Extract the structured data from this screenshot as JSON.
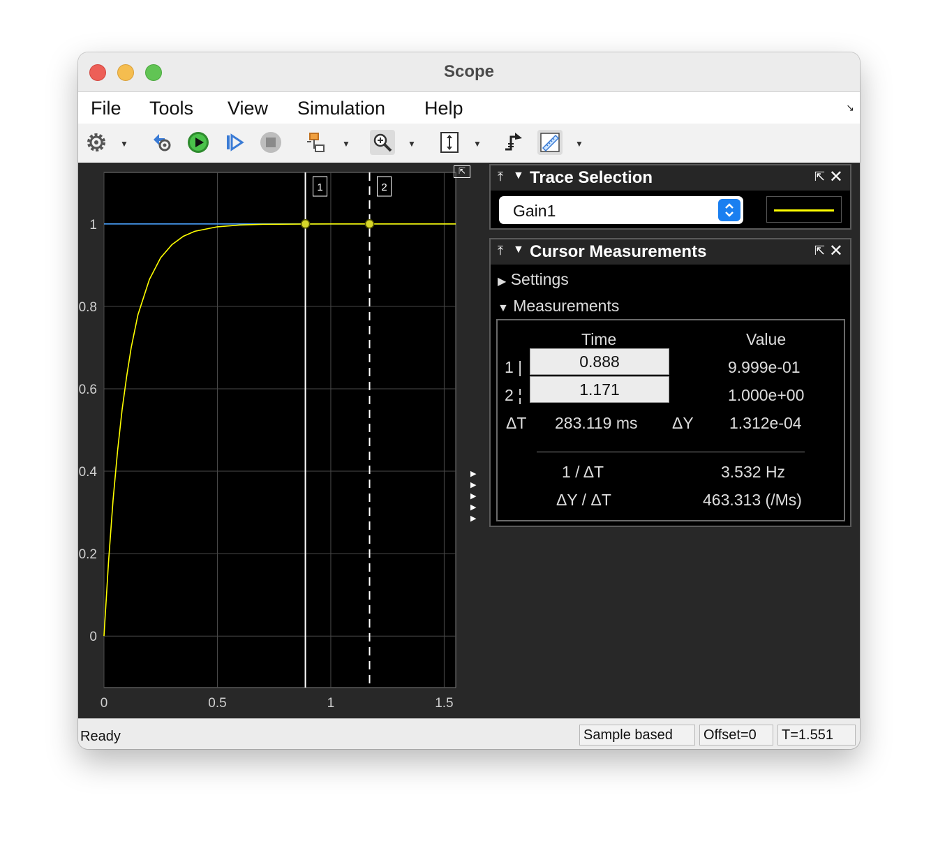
{
  "window": {
    "title": "Scope"
  },
  "menu": [
    "File",
    "Tools",
    "View",
    "Simulation",
    "Help"
  ],
  "toolbar": {
    "icons": [
      "gear-icon",
      "step-back-icon",
      "run-icon",
      "step-forward-icon",
      "stop-icon",
      "highlight-block-icon",
      "zoom-in-icon",
      "scale-axes-icon",
      "triggers-icon",
      "cursor-measurements-icon"
    ]
  },
  "chart_data": {
    "type": "line",
    "title": "",
    "xlabel": "",
    "ylabel": "",
    "xlim": [
      0,
      1.551
    ],
    "ylim": [
      -0.125,
      1.125
    ],
    "x_ticks": [
      "0",
      "0.5",
      "1",
      "1.5"
    ],
    "y_ticks": [
      "0",
      "0.2",
      "0.4",
      "0.6",
      "0.8",
      "1"
    ],
    "grid": true,
    "series": [
      {
        "color": "#ffff00",
        "x": [
          0,
          0.02,
          0.04,
          0.06,
          0.08,
          0.1,
          0.12,
          0.15,
          0.2,
          0.25,
          0.3,
          0.35,
          0.4,
          0.5,
          0.6,
          0.7,
          0.888,
          1.0,
          1.171,
          1.3,
          1.551
        ],
        "y": [
          0,
          0.18,
          0.33,
          0.45,
          0.55,
          0.63,
          0.7,
          0.78,
          0.865,
          0.918,
          0.95,
          0.97,
          0.982,
          0.993,
          0.9975,
          0.9991,
          0.9999,
          1.0,
          1.0,
          1.0,
          1.0
        ]
      },
      {
        "color": "#4aa3ff",
        "x": [
          0,
          1.551
        ],
        "y": [
          1,
          1
        ]
      }
    ],
    "cursors": [
      {
        "label": "1",
        "x": 0.888,
        "style": "solid"
      },
      {
        "label": "2",
        "x": 1.171,
        "style": "dashed"
      }
    ]
  },
  "trace_selection": {
    "title": "Trace Selection",
    "selected": "Gain1",
    "line_color": "#ffff00"
  },
  "cursor_measurements": {
    "title": "Cursor Measurements",
    "settings_label": "Settings",
    "measurements_label": "Measurements",
    "col_time": "Time",
    "col_value": "Value",
    "row1_label": "1 |",
    "row1_time": "0.888",
    "row1_value": "9.999e-01",
    "row2_label": "2 ¦",
    "row2_time": "1.171",
    "row2_value": "1.000e+00",
    "dt_label": "ΔT",
    "dt_value": "283.119 ms",
    "dy_label": "ΔY",
    "dy_value": "1.312e-04",
    "inv_dt_label": "1 / ΔT",
    "inv_dt_value": "3.532 Hz",
    "dydt_label": "ΔY / ΔT",
    "dydt_value": "463.313 (/Ms)"
  },
  "status": {
    "ready": "Ready",
    "mode": "Sample based",
    "offset": "Offset=0",
    "time": "T=1.551"
  }
}
